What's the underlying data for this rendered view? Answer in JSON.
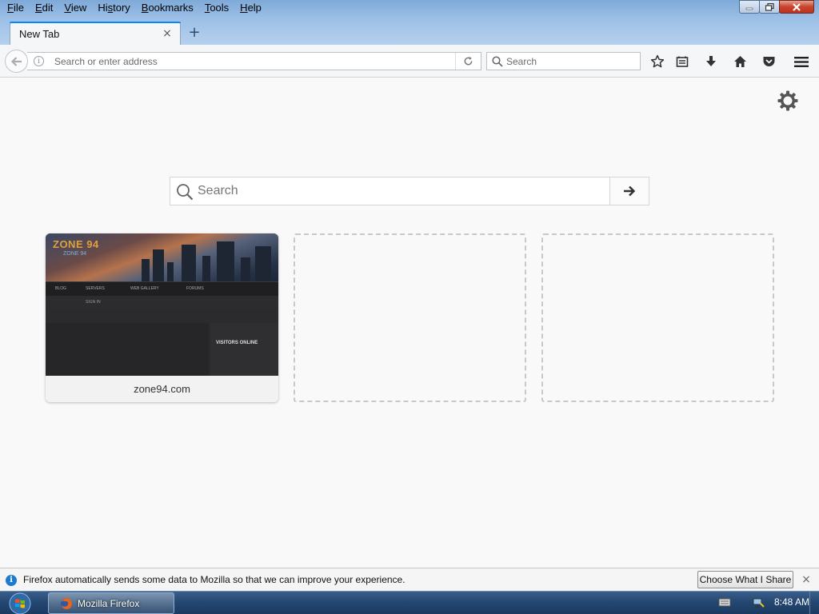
{
  "menubar": {
    "items": [
      {
        "pre": "",
        "u": "F",
        "post": "ile"
      },
      {
        "pre": "",
        "u": "E",
        "post": "dit"
      },
      {
        "pre": "",
        "u": "V",
        "post": "iew"
      },
      {
        "pre": "Hi",
        "u": "s",
        "post": "tory"
      },
      {
        "pre": "",
        "u": "B",
        "post": "ookmarks"
      },
      {
        "pre": "",
        "u": "T",
        "post": "ools"
      },
      {
        "pre": "",
        "u": "H",
        "post": "elp"
      }
    ]
  },
  "tab": {
    "title": "New Tab",
    "close_symbol": "×",
    "new_tab_symbol": "+"
  },
  "navbar": {
    "url_placeholder": "Search or enter address",
    "search_placeholder": "Search"
  },
  "newtab": {
    "search_placeholder": "Search",
    "tiles": [
      {
        "label": "zone94.com",
        "filled": true
      },
      {
        "label": "",
        "filled": false
      },
      {
        "label": "",
        "filled": false
      }
    ],
    "thumb": {
      "logo": "ZONE 94",
      "logo_sub": "ZONE 94",
      "nav": [
        "BLOG",
        "SERVERS",
        "WEB GALLERY",
        "FORUMS",
        "SIGN IN"
      ],
      "side_title": "VISITORS ONLINE"
    }
  },
  "notification": {
    "message": "Firefox automatically sends some data to Mozilla so that we can improve your experience.",
    "button_label": "Choose What I Share",
    "close_symbol": "×"
  },
  "taskbar": {
    "task_label": "Mozilla Firefox",
    "clock": "8:48 AM"
  },
  "colors": {
    "accent": "#0a84ff",
    "info_blue": "#1b7ad1",
    "taskbar": "#234670"
  },
  "icons": [
    "back-arrow-icon",
    "info-icon",
    "reload-icon",
    "search-icon",
    "bookmark-star-icon",
    "reading-list-icon",
    "download-icon",
    "home-icon",
    "pocket-icon",
    "hamburger-menu-icon",
    "gear-icon",
    "arrow-right-icon",
    "windows-start-icon",
    "firefox-icon"
  ]
}
